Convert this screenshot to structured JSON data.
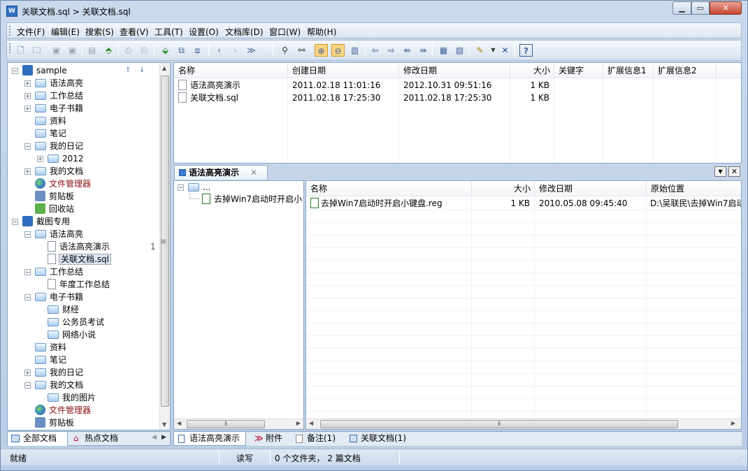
{
  "window": {
    "title": "关联文档.sql > 关联文档.sql",
    "min": "▁",
    "max": "▭",
    "close": "✕"
  },
  "menu": [
    "文件(F)",
    "编辑(E)",
    "搜索(S)",
    "查看(V)",
    "工具(T)",
    "设置(O)",
    "文档库(D)",
    "窗口(W)",
    "帮助(H)"
  ],
  "toolbar_icons": [
    "new-icon",
    "open-icon",
    "save-icon",
    "save-all-icon",
    "save-as-icon",
    "export-icon",
    "print-icon",
    "print-preview-icon",
    "import-icon",
    "copy-icon",
    "paste-icon",
    "back-icon",
    "forward-icon",
    "jump-icon",
    "find-icon",
    "find-replace-icon",
    "zoom-in-icon",
    "zoom-out-icon",
    "fit-icon",
    "nav-left-icon",
    "nav-right-icon",
    "nav-first-icon",
    "nav-last-icon",
    "properties-icon",
    "attach-icon",
    "pen-icon",
    "dropdown-icon",
    "delete-icon",
    "help-icon"
  ],
  "tree": [
    {
      "label": "sample",
      "level": 0,
      "exp": "-",
      "icon": "db"
    },
    {
      "label": "语法高亮",
      "level": 1,
      "exp": "+",
      "icon": "folder"
    },
    {
      "label": "工作总结",
      "level": 1,
      "exp": "+",
      "icon": "folder"
    },
    {
      "label": "电子书籍",
      "level": 1,
      "exp": "+",
      "icon": "folder"
    },
    {
      "label": "资料",
      "level": 1,
      "exp": "",
      "icon": "folder"
    },
    {
      "label": "笔记",
      "level": 1,
      "exp": "",
      "icon": "folder"
    },
    {
      "label": "我的日记",
      "level": 1,
      "exp": "-",
      "icon": "folder"
    },
    {
      "label": "2012",
      "level": 2,
      "exp": "+",
      "icon": "folder"
    },
    {
      "label": "我的文档",
      "level": 1,
      "exp": "+",
      "icon": "folder"
    },
    {
      "label": "文件管理器",
      "level": 1,
      "exp": "",
      "icon": "globe",
      "red": true
    },
    {
      "label": "剪贴板",
      "level": 1,
      "exp": "",
      "icon": "clip"
    },
    {
      "label": "回收站",
      "level": 1,
      "exp": "",
      "icon": "recycle"
    },
    {
      "label": "截图专用",
      "level": 0,
      "exp": "-",
      "icon": "db"
    },
    {
      "label": "语法高亮",
      "level": 1,
      "exp": "-",
      "icon": "folder"
    },
    {
      "label": "语法高亮演示",
      "level": 2,
      "exp": "",
      "icon": "doc",
      "count": "1"
    },
    {
      "label": "关联文档.sql",
      "level": 2,
      "exp": "",
      "icon": "doc",
      "selected": true
    },
    {
      "label": "工作总结",
      "level": 1,
      "exp": "-",
      "icon": "folder"
    },
    {
      "label": "年度工作总结",
      "level": 2,
      "exp": "",
      "icon": "doc"
    },
    {
      "label": "电子书籍",
      "level": 1,
      "exp": "-",
      "icon": "folder"
    },
    {
      "label": "财经",
      "level": 2,
      "exp": "",
      "icon": "folder"
    },
    {
      "label": "公务员考试",
      "level": 2,
      "exp": "",
      "icon": "folder"
    },
    {
      "label": "网络小说",
      "level": 2,
      "exp": "",
      "icon": "folder"
    },
    {
      "label": "资料",
      "level": 1,
      "exp": "",
      "icon": "folder"
    },
    {
      "label": "笔记",
      "level": 1,
      "exp": "",
      "icon": "folder"
    },
    {
      "label": "我的日记",
      "level": 1,
      "exp": "+",
      "icon": "folder"
    },
    {
      "label": "我的文档",
      "level": 1,
      "exp": "-",
      "icon": "folder"
    },
    {
      "label": "我的图片",
      "level": 2,
      "exp": "",
      "icon": "folder"
    },
    {
      "label": "文件管理器",
      "level": 1,
      "exp": "",
      "icon": "globe",
      "red": true
    },
    {
      "label": "剪贴板",
      "level": 1,
      "exp": "",
      "icon": "clip"
    }
  ],
  "left_tabs": {
    "all": "全部文档",
    "hot": "热点文档"
  },
  "list1": {
    "headers": [
      "名称",
      "创建日期",
      "修改日期",
      "大小",
      "关键字",
      "扩展信息1",
      "扩展信息2"
    ],
    "rows": [
      [
        "语法高亮演示",
        "2011.02.18 11:01:16",
        "2012.10.31 09:51:16",
        "1 KB"
      ],
      [
        "关联文档.sql",
        "2011.02.18 17:25:30",
        "2011.02.18 17:25:30",
        "1 KB"
      ]
    ]
  },
  "preview": {
    "tab": "语法高亮演示",
    "tree_root": "...",
    "tree_child": "去掉Win7启动时开启小",
    "headers": [
      "名称",
      "大小",
      "修改日期",
      "原始位置"
    ],
    "row": [
      "去掉Win7启动时开启小键盘.reg",
      "1 KB",
      "2010.05.08 09:45:40",
      "D:\\吴联民\\去掉Win7启动"
    ]
  },
  "bottom_tabs": [
    "语法高亮演示",
    "附件",
    "备注(1)",
    "关联文档(1)"
  ],
  "status": {
    "ready": "就绪",
    "mode": "读写",
    "counts": "0 个文件夹， 2 篇文档"
  }
}
